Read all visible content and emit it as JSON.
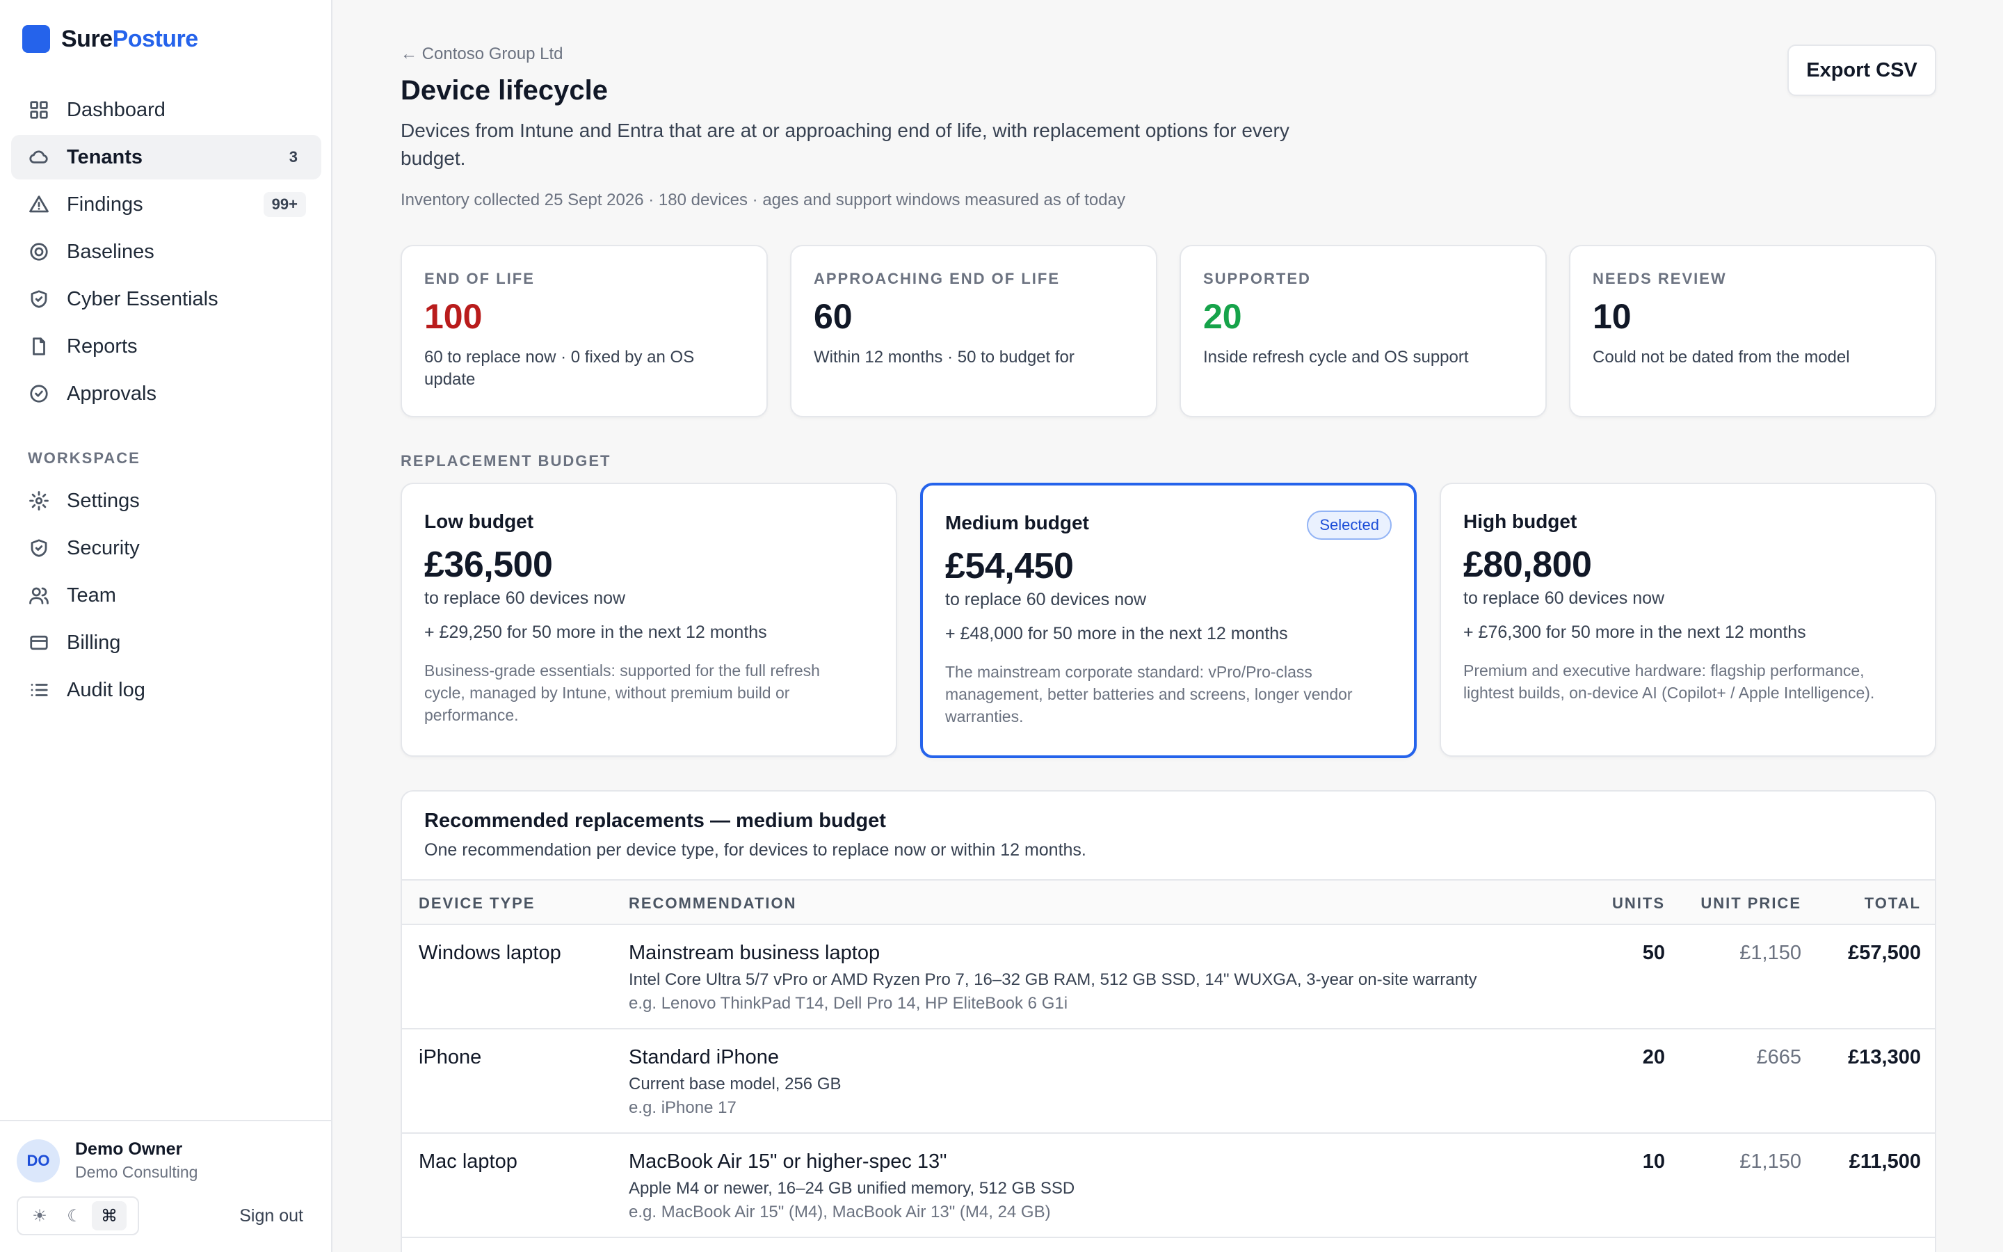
{
  "brand": {
    "part1": "Sure",
    "part2": "Posture"
  },
  "nav": [
    {
      "label": "Dashboard",
      "icon": "grid-icon",
      "badge": ""
    },
    {
      "label": "Tenants",
      "icon": "cloud-icon",
      "badge": "3",
      "active": true
    },
    {
      "label": "Findings",
      "icon": "warning-icon",
      "badge": "99+"
    },
    {
      "label": "Baselines",
      "icon": "target-icon",
      "badge": ""
    },
    {
      "label": "Cyber Essentials",
      "icon": "shield-check-icon",
      "badge": ""
    },
    {
      "label": "Reports",
      "icon": "document-icon",
      "badge": ""
    },
    {
      "label": "Approvals",
      "icon": "check-circle-icon",
      "badge": ""
    }
  ],
  "workspace_label": "WORKSPACE",
  "workspace": [
    {
      "label": "Settings",
      "icon": "gear-icon"
    },
    {
      "label": "Security",
      "icon": "shield-icon"
    },
    {
      "label": "Team",
      "icon": "users-icon"
    },
    {
      "label": "Billing",
      "icon": "credit-card-icon"
    },
    {
      "label": "Audit log",
      "icon": "list-icon"
    }
  ],
  "user": {
    "initials": "DO",
    "name": "Demo Owner",
    "org": "Demo Consulting"
  },
  "theme": {
    "light": "☀",
    "dark": "☾",
    "system": "⌘"
  },
  "sign_out": "Sign out",
  "header": {
    "back": "← Contoso Group Ltd",
    "title": "Device lifecycle",
    "description": "Devices from Intune and Entra that are at or approaching end of life, with replacement options for every budget.",
    "meta": "Inventory collected 25 Sept 2026 · 180 devices · ages and support windows measured as of today",
    "export_label": "Export CSV"
  },
  "stats": [
    {
      "label": "END OF LIFE",
      "value": "100",
      "sub": "60 to replace now · 0 fixed by an OS update",
      "color": "#b91c1c"
    },
    {
      "label": "APPROACHING END OF LIFE",
      "value": "60",
      "sub": "Within 12 months · 50 to budget for",
      "color": "#111827"
    },
    {
      "label": "SUPPORTED",
      "value": "20",
      "sub": "Inside refresh cycle and OS support",
      "color": "#16a34a"
    },
    {
      "label": "NEEDS REVIEW",
      "value": "10",
      "sub": "Could not be dated from the model",
      "color": "#111827"
    }
  ],
  "budget_section_label": "REPLACEMENT BUDGET",
  "budgets": [
    {
      "name": "Low budget",
      "amount": "£36,500",
      "sub": "to replace 60 devices now",
      "more": "+ £29,250 for 50 more in the next 12 months",
      "desc": "Business-grade essentials: supported for the full refresh cycle, managed by Intune, without premium build or performance.",
      "selected": false
    },
    {
      "name": "Medium budget",
      "amount": "£54,450",
      "sub": "to replace 60 devices now",
      "more": "+ £48,000 for 50 more in the next 12 months",
      "desc": "The mainstream corporate standard: vPro/Pro-class management, better batteries and screens, longer vendor warranties.",
      "selected": true,
      "badge": "Selected"
    },
    {
      "name": "High budget",
      "amount": "£80,800",
      "sub": "to replace 60 devices now",
      "more": "+ £76,300 for 50 more in the next 12 months",
      "desc": "Premium and executive hardware: flagship performance, lightest builds, on-device AI (Copilot+ / Apple Intelligence).",
      "selected": false
    }
  ],
  "recommendations": {
    "title": "Recommended replacements — medium budget",
    "subtitle": "One recommendation per device type, for devices to replace now or within 12 months.",
    "columns": {
      "type": "DEVICE TYPE",
      "rec": "RECOMMENDATION",
      "units": "UNITS",
      "price": "UNIT PRICE",
      "total": "TOTAL"
    },
    "rows": [
      {
        "type": "Windows laptop",
        "name": "Mainstream business laptop",
        "spec": "Intel Core Ultra 5/7 vPro or AMD Ryzen Pro 7, 16–32 GB RAM, 512 GB SSD, 14\" WUXGA, 3-year on-site warranty",
        "eg": "e.g. Lenovo ThinkPad T14, Dell Pro 14, HP EliteBook 6 G1i",
        "units": "50",
        "price": "£1,150",
        "total": "£57,500"
      },
      {
        "type": "iPhone",
        "name": "Standard iPhone",
        "spec": "Current base model, 256 GB",
        "eg": "e.g. iPhone 17",
        "units": "20",
        "price": "£665",
        "total": "£13,300"
      },
      {
        "type": "Mac laptop",
        "name": "MacBook Air 15\" or higher-spec 13\"",
        "spec": "Apple M4 or newer, 16–24 GB unified memory, 512 GB SSD",
        "eg": "e.g. MacBook Air 15\" (M4), MacBook Air 13\" (M4, 24 GB)",
        "units": "10",
        "price": "£1,150",
        "total": "£11,500"
      }
    ]
  }
}
